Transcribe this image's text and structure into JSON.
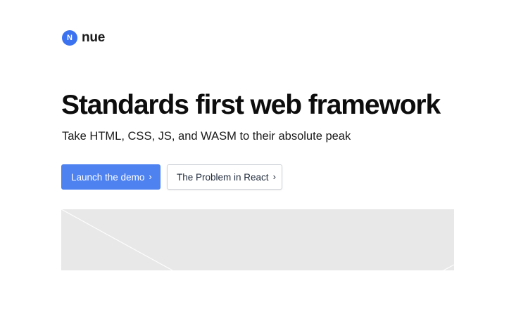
{
  "brand": {
    "mark_letter": "N",
    "name": "nue",
    "accent_color": "#3b72f0"
  },
  "hero": {
    "title": "Standards first web framework",
    "subtitle": "Take HTML, CSS, JS, and WASM to their absolute peak"
  },
  "cta": {
    "primary_label": "Launch the demo",
    "primary_color": "#4d82f0",
    "secondary_label": "The Problem in React",
    "chevron": "›"
  },
  "preview": {
    "icon": "image-placeholder-icon",
    "background": "#e8e8e8"
  }
}
